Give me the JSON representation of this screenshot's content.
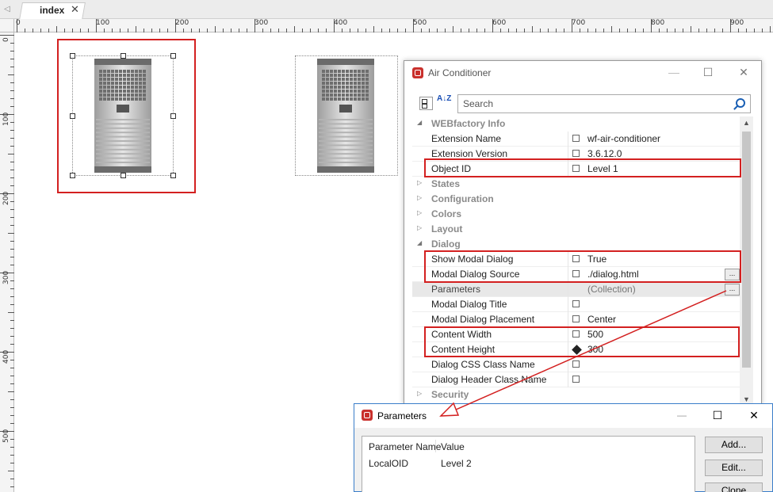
{
  "tabs": {
    "scroll_left": "◁",
    "active_label": "index",
    "close_glyph": "✕"
  },
  "ruler": {
    "top_labels": [
      "0",
      "100",
      "200",
      "300",
      "400",
      "500",
      "600",
      "700",
      "800",
      "900"
    ],
    "left_labels": [
      "0",
      "100",
      "200",
      "300",
      "400",
      "500"
    ]
  },
  "ac_window": {
    "title": "Air Conditioner",
    "minimize": "—",
    "maximize": "☐",
    "close": "✕",
    "search_placeholder": "Search",
    "az_sort_label": "A↓Z",
    "categories": {
      "webfactory": "WEBfactory Info",
      "states": "States",
      "configuration": "Configuration",
      "colors": "Colors",
      "layout": "Layout",
      "dialog": "Dialog",
      "security": "Security"
    },
    "expand_open": "◢",
    "expand_closed": "▷",
    "properties": {
      "extension_name": {
        "name": "Extension Name",
        "value": "wf-air-conditioner"
      },
      "extension_version": {
        "name": "Extension Version",
        "value": "3.6.12.0"
      },
      "object_id": {
        "name": "Object ID",
        "value": "Level 1"
      },
      "show_modal_dialog": {
        "name": "Show Modal Dialog",
        "value": "True"
      },
      "modal_dialog_source": {
        "name": "Modal Dialog Source",
        "value": "./dialog.html"
      },
      "parameters": {
        "name": "Parameters",
        "value": "(Collection)"
      },
      "modal_dialog_title": {
        "name": "Modal Dialog Title",
        "value": ""
      },
      "modal_dialog_placement": {
        "name": "Modal Dialog Placement",
        "value": "Center"
      },
      "content_width": {
        "name": "Content Width",
        "value": "500"
      },
      "content_height": {
        "name": "Content Height",
        "value": "300"
      },
      "dialog_css_class": {
        "name": "Dialog CSS Class Name",
        "value": ""
      },
      "dialog_header_class": {
        "name": "Dialog Header Class Name",
        "value": ""
      }
    },
    "ellipsis": "..."
  },
  "param_window": {
    "title": "Parameters",
    "minimize": "—",
    "maximize": "☐",
    "close": "✕",
    "columns": [
      "Parameter Name",
      "Value"
    ],
    "rows": [
      {
        "name": "LocalOID",
        "value": "Level 2"
      }
    ],
    "buttons": {
      "add": "Add...",
      "edit": "Edit...",
      "clone": "Clone"
    }
  },
  "colors": {
    "highlight_red": "#d32020",
    "app_icon_red": "#c9302c"
  }
}
